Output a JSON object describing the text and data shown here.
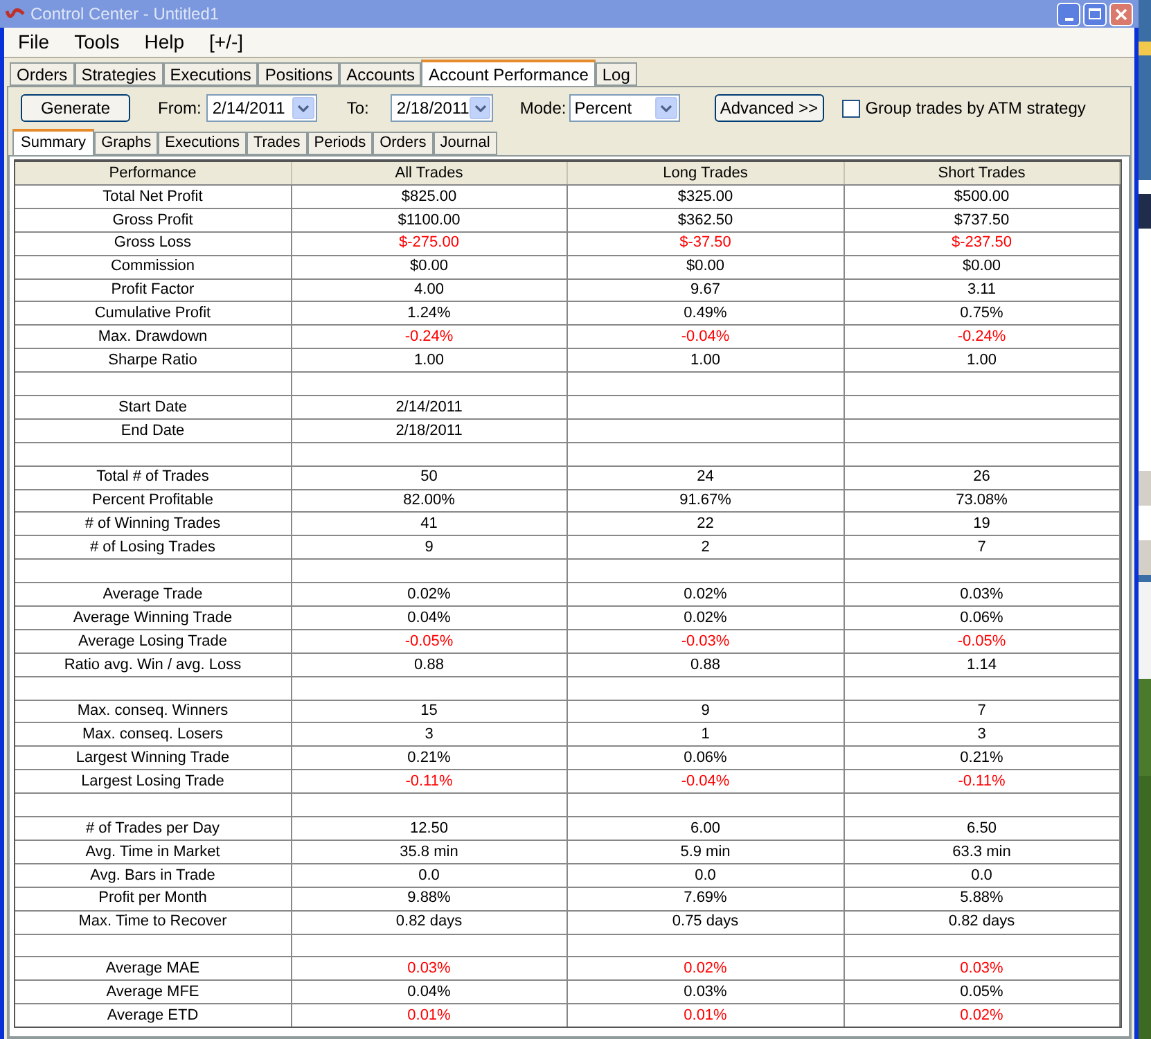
{
  "window": {
    "title": "Control Center - Untitled1"
  },
  "menu": [
    "File",
    "Tools",
    "Help",
    "[+/-]"
  ],
  "tabs": [
    {
      "label": "Orders",
      "selected": false
    },
    {
      "label": "Strategies",
      "selected": false
    },
    {
      "label": "Executions",
      "selected": false
    },
    {
      "label": "Positions",
      "selected": false
    },
    {
      "label": "Accounts",
      "selected": false
    },
    {
      "label": "Account Performance",
      "selected": true
    },
    {
      "label": "Log",
      "selected": false
    }
  ],
  "toolbar": {
    "generate": "Generate",
    "from_label": "From:",
    "from": "2/14/2011",
    "to_label": "To:",
    "to": "2/18/2011",
    "mode_label": "Mode:",
    "mode": "Percent",
    "advanced": "Advanced >>",
    "group_label": "Group trades by ATM strategy",
    "group_checked": false
  },
  "subtabs": [
    {
      "label": "Summary",
      "selected": true
    },
    {
      "label": "Graphs",
      "selected": false
    },
    {
      "label": "Executions",
      "selected": false
    },
    {
      "label": "Trades",
      "selected": false
    },
    {
      "label": "Periods",
      "selected": false
    },
    {
      "label": "Orders",
      "selected": false
    },
    {
      "label": "Journal",
      "selected": false
    }
  ],
  "table": {
    "columns": [
      "Performance",
      "All Trades",
      "Long Trades",
      "Short Trades"
    ],
    "rows": [
      {
        "kind": "data",
        "label": "Total Net Profit",
        "values": [
          "$825.00",
          "$325.00",
          "$500.00"
        ],
        "negative": false
      },
      {
        "kind": "data",
        "label": "Gross Profit",
        "values": [
          "$1100.00",
          "$362.50",
          "$737.50"
        ],
        "negative": false
      },
      {
        "kind": "data",
        "label": "Gross Loss",
        "values": [
          "$-275.00",
          "$-37.50",
          "$-237.50"
        ],
        "negative": true
      },
      {
        "kind": "data",
        "label": "Commission",
        "values": [
          "$0.00",
          "$0.00",
          "$0.00"
        ],
        "negative": false
      },
      {
        "kind": "data",
        "label": "Profit Factor",
        "values": [
          "4.00",
          "9.67",
          "3.11"
        ],
        "negative": false
      },
      {
        "kind": "data",
        "label": "Cumulative Profit",
        "values": [
          "1.24%",
          "0.49%",
          "0.75%"
        ],
        "negative": false
      },
      {
        "kind": "data",
        "label": "Max. Drawdown",
        "values": [
          "-0.24%",
          "-0.04%",
          "-0.24%"
        ],
        "negative": true
      },
      {
        "kind": "data",
        "label": "Sharpe Ratio",
        "values": [
          "1.00",
          "1.00",
          "1.00"
        ],
        "negative": false
      },
      {
        "kind": "blank"
      },
      {
        "kind": "data",
        "label": "Start Date",
        "values": [
          "2/14/2011"
        ],
        "negative": false
      },
      {
        "kind": "data",
        "label": "End Date",
        "values": [
          "2/18/2011"
        ],
        "negative": false
      },
      {
        "kind": "blank"
      },
      {
        "kind": "data",
        "label": "Total # of Trades",
        "values": [
          "50",
          "24",
          "26"
        ],
        "negative": false
      },
      {
        "kind": "data",
        "label": "Percent Profitable",
        "values": [
          "82.00%",
          "91.67%",
          "73.08%"
        ],
        "negative": false
      },
      {
        "kind": "data",
        "label": "# of Winning Trades",
        "values": [
          "41",
          "22",
          "19"
        ],
        "negative": false
      },
      {
        "kind": "data",
        "label": "# of Losing Trades",
        "values": [
          "9",
          "2",
          "7"
        ],
        "negative": false
      },
      {
        "kind": "blank"
      },
      {
        "kind": "data",
        "label": "Average Trade",
        "values": [
          "0.02%",
          "0.02%",
          "0.03%"
        ],
        "negative": false
      },
      {
        "kind": "data",
        "label": "Average Winning Trade",
        "values": [
          "0.04%",
          "0.02%",
          "0.06%"
        ],
        "negative": false
      },
      {
        "kind": "data",
        "label": "Average Losing Trade",
        "values": [
          "-0.05%",
          "-0.03%",
          "-0.05%"
        ],
        "negative": true
      },
      {
        "kind": "data",
        "label": "Ratio avg. Win / avg. Loss",
        "values": [
          "0.88",
          "0.88",
          "1.14"
        ],
        "negative": false
      },
      {
        "kind": "blank"
      },
      {
        "kind": "data",
        "label": "Max. conseq. Winners",
        "values": [
          "15",
          "9",
          "7"
        ],
        "negative": false
      },
      {
        "kind": "data",
        "label": "Max. conseq. Losers",
        "values": [
          "3",
          "1",
          "3"
        ],
        "negative": false
      },
      {
        "kind": "data",
        "label": "Largest Winning Trade",
        "values": [
          "0.21%",
          "0.06%",
          "0.21%"
        ],
        "negative": false
      },
      {
        "kind": "data",
        "label": "Largest Losing Trade",
        "values": [
          "-0.11%",
          "-0.04%",
          "-0.11%"
        ],
        "negative": true
      },
      {
        "kind": "blank"
      },
      {
        "kind": "data",
        "label": "# of Trades per Day",
        "values": [
          "12.50",
          "6.00",
          "6.50"
        ],
        "negative": false
      },
      {
        "kind": "data",
        "label": "Avg. Time in Market",
        "values": [
          "35.8 min",
          "5.9 min",
          "63.3 min"
        ],
        "negative": false
      },
      {
        "kind": "data",
        "label": "Avg. Bars in Trade",
        "values": [
          "0.0",
          "0.0",
          "0.0"
        ],
        "negative": false
      },
      {
        "kind": "data",
        "label": "Profit per Month",
        "values": [
          "9.88%",
          "7.69%",
          "5.88%"
        ],
        "negative": false
      },
      {
        "kind": "data",
        "label": "Max. Time to Recover",
        "values": [
          "0.82 days",
          "0.75 days",
          "0.82 days"
        ],
        "negative": false
      },
      {
        "kind": "blank"
      },
      {
        "kind": "data",
        "label": "Average MAE",
        "values": [
          "0.03%",
          "0.02%",
          "0.03%"
        ],
        "negative": true
      },
      {
        "kind": "data",
        "label": "Average MFE",
        "values": [
          "0.04%",
          "0.03%",
          "0.05%"
        ],
        "negative": false
      },
      {
        "kind": "data",
        "label": "Average ETD",
        "values": [
          "0.01%",
          "0.01%",
          "0.02%"
        ],
        "negative": true
      }
    ]
  }
}
